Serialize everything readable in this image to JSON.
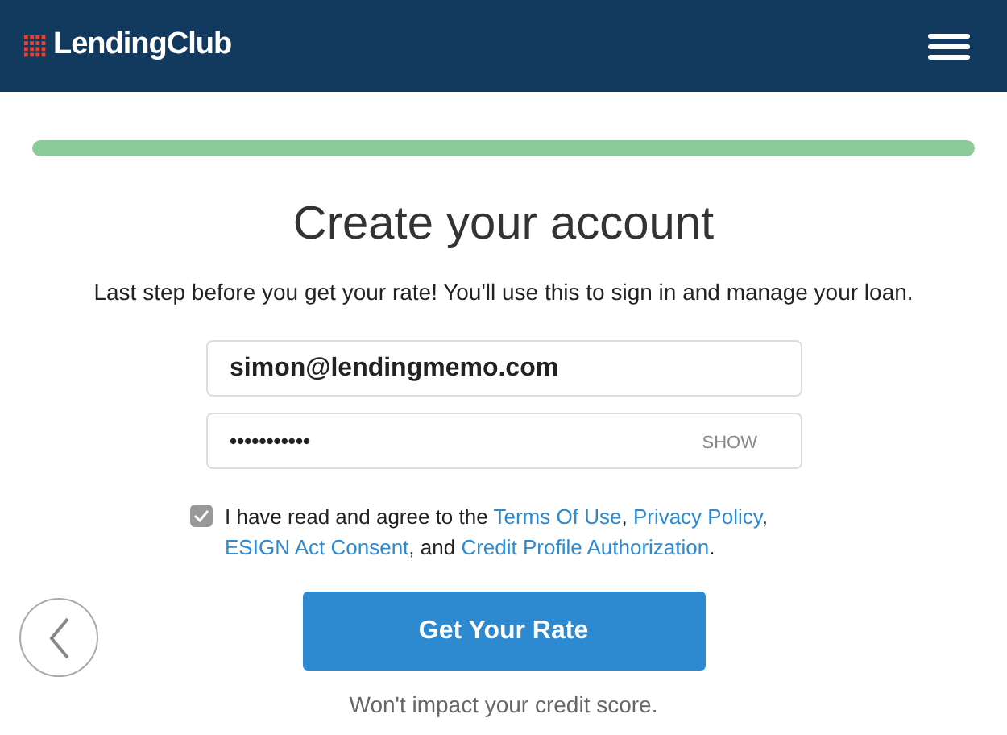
{
  "header": {
    "logo": "LendingClub"
  },
  "progress": {
    "level": 1
  },
  "title": "Create your account",
  "subtitle": "Last step before you get your rate! You'll use this to sign in and manage your loan.",
  "email": {
    "value": "simon@lendingmemo.com"
  },
  "password": {
    "value": "•••••••••••",
    "toggle": "SHOW"
  },
  "agreement": {
    "checked": true,
    "parts": [
      {
        "kind": "text",
        "text": "I have read and agree to the "
      },
      {
        "kind": "link",
        "text": "Terms Of Use"
      },
      {
        "kind": "text",
        "text": ", "
      },
      {
        "kind": "link",
        "text": "Privacy Policy"
      },
      {
        "kind": "text",
        "text": ", "
      },
      {
        "kind": "link",
        "text": "ESIGN Act Consent"
      },
      {
        "kind": "text",
        "text": ", and "
      },
      {
        "kind": "link",
        "text": "Credit Profile Authorization"
      },
      {
        "kind": "text",
        "text": "."
      }
    ]
  },
  "submit": "Get Your Rate",
  "note": "Won't impact your credit score."
}
